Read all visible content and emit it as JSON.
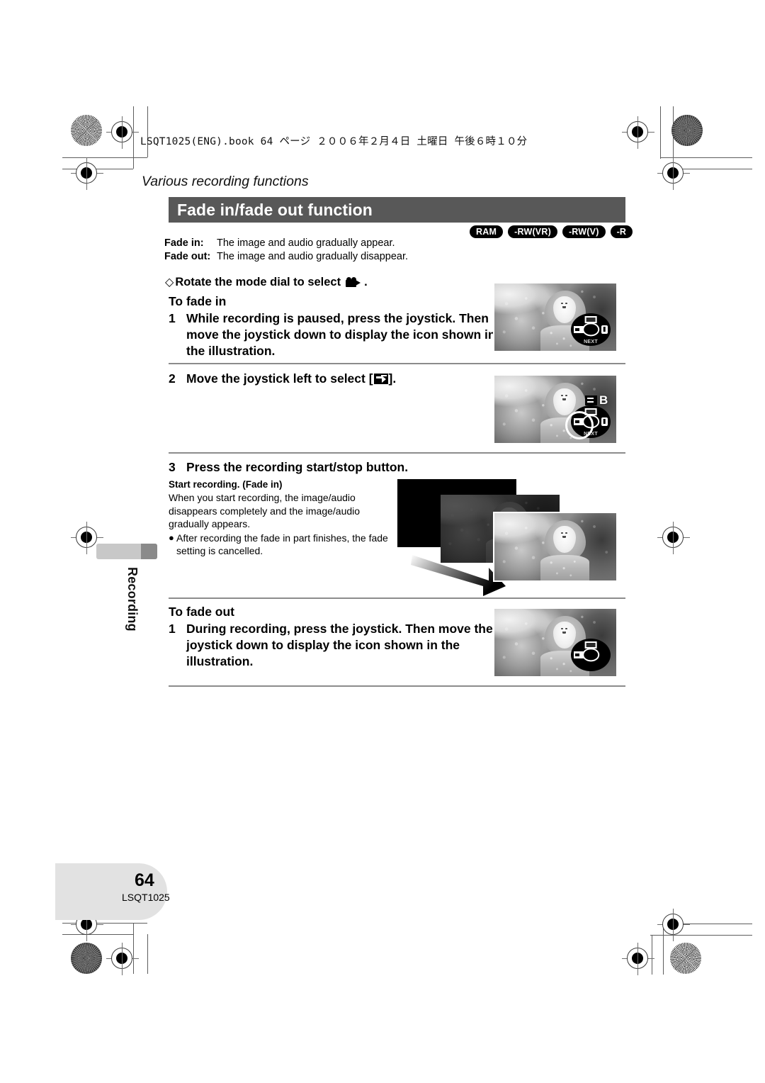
{
  "page": {
    "file_info": "LSQT1025(ENG).book  64 ページ  ２００６年２月４日  土曜日  午後６時１０分",
    "running_head": "Various recording functions",
    "title": "Fade in/fade out function",
    "side_tab": "Recording",
    "page_number": "64",
    "page_code": "LSQT1025"
  },
  "badges": [
    {
      "label": "RAM"
    },
    {
      "label": "-RW(VR)"
    },
    {
      "label": "-RW(V)"
    },
    {
      "label": "-R"
    }
  ],
  "definitions": [
    {
      "term": "Fade in:",
      "desc": "The image and audio gradually appear."
    },
    {
      "term": "Fade out:",
      "desc": "The image and audio gradually disappear."
    }
  ],
  "mode_dial": {
    "diamond": "◇",
    "text": "Rotate the mode dial to select",
    "icon": "camcorder-icon",
    "period": "."
  },
  "fade_in": {
    "heading": "To fade in",
    "steps": [
      {
        "num": "1",
        "text": "While recording is paused, press the joystick. Then move the joystick down to display the icon shown in the illustration."
      },
      {
        "num": "2",
        "text_before": "Move the joystick left to select [",
        "icon": "fade-arrow-icon",
        "text_after": "]."
      },
      {
        "num": "3",
        "text": "Press the recording start/stop button."
      }
    ],
    "note_head": "Start recording. (Fade in)",
    "note_body": "When you start recording, the image/audio disappears completely and the image/audio gradually appears.",
    "note_bullet_dot": "●",
    "note_bullet": "After recording the fade in part finishes, the fade setting is cancelled."
  },
  "fade_out": {
    "heading": "To fade out",
    "steps": [
      {
        "num": "1",
        "text": "During recording, press the joystick. Then move the joystick down to display the icon shown in the illustration."
      }
    ]
  },
  "osd": {
    "next_label": "NEXT",
    "fade_b_label": "B"
  },
  "colors": {
    "title_bar": "#585858",
    "badge": "#000000",
    "rule": "#8c8c8c",
    "side_tab": "#c8c8c8",
    "page_badge": "#e2e2e2"
  }
}
